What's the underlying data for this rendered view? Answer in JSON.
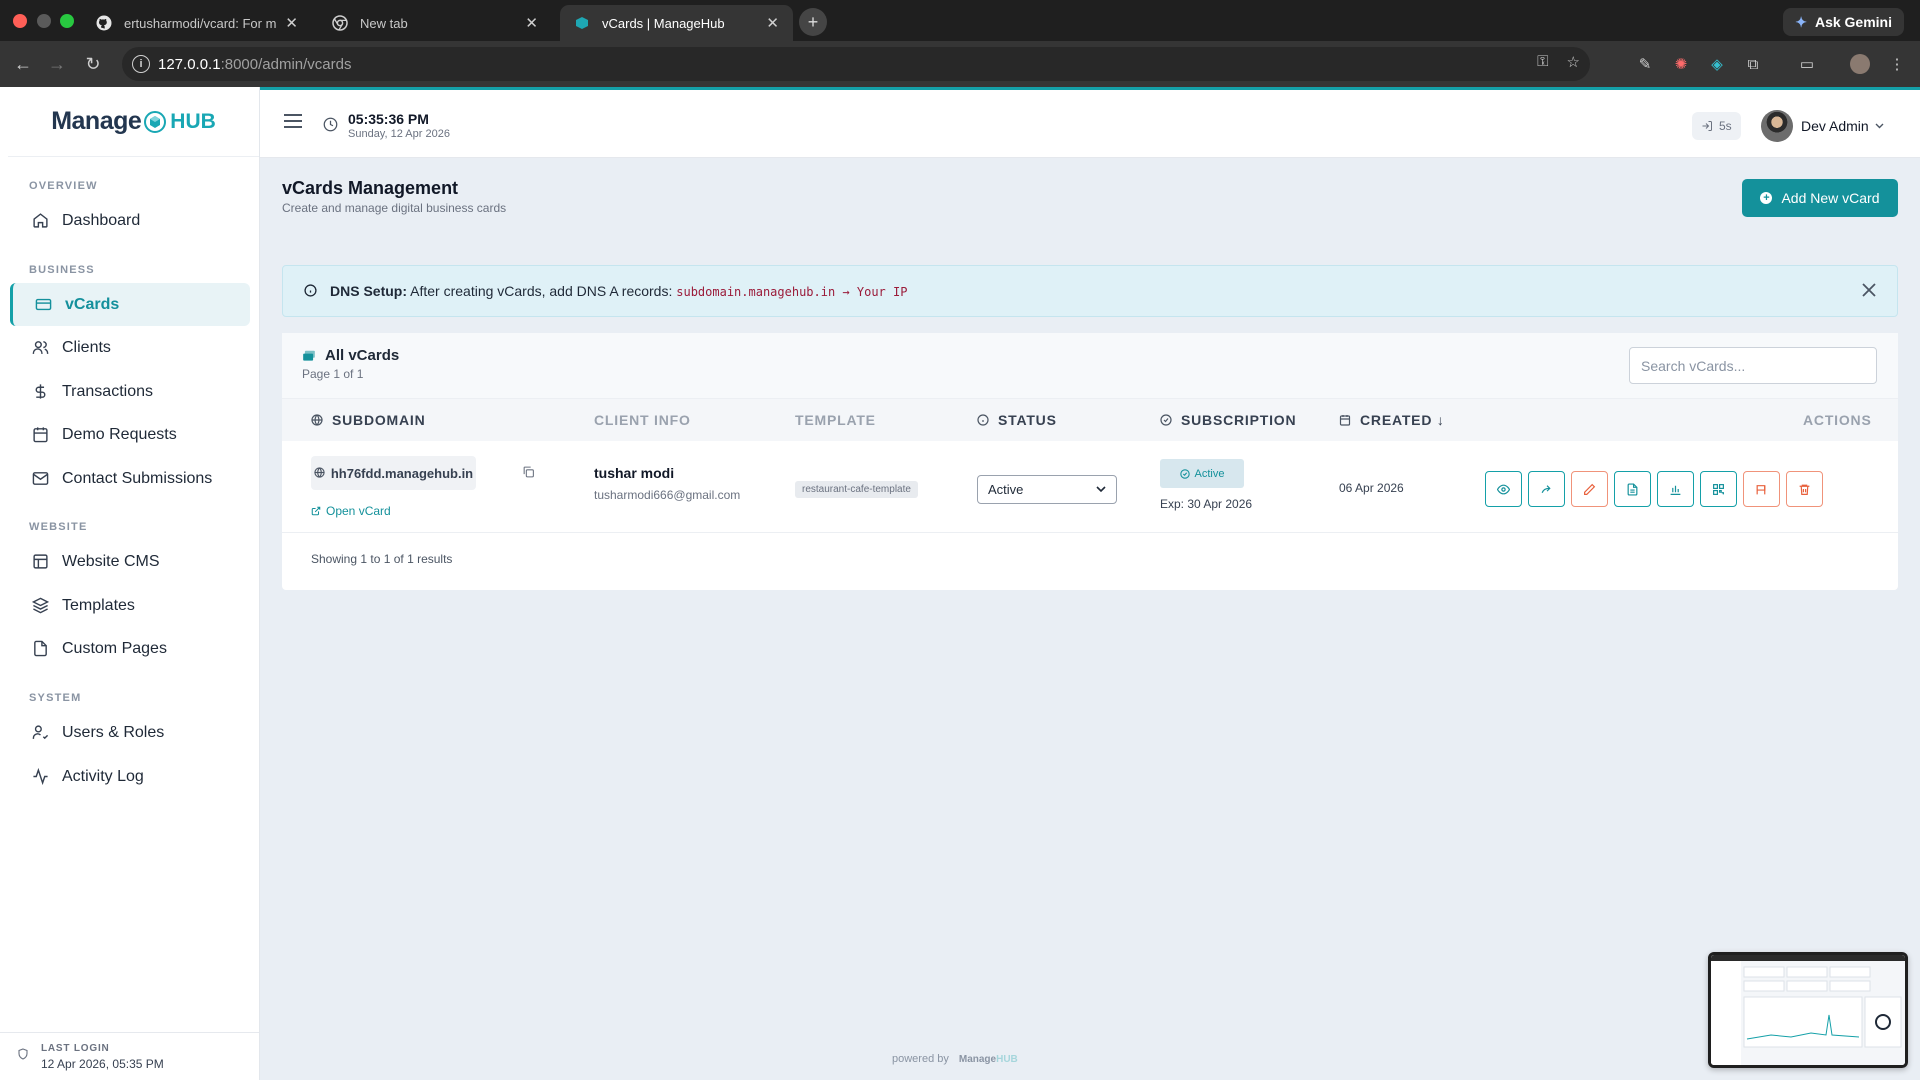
{
  "browser": {
    "tabs": [
      {
        "title": "ertusharmodi/vcard: For mana",
        "favicon": "github-icon"
      },
      {
        "title": "New tab",
        "favicon": "chrome-icon"
      },
      {
        "title": "vCards | ManageHub",
        "favicon": "managehub-icon"
      }
    ],
    "ask_gemini": "Ask Gemini",
    "url_host": "127.0.0.1",
    "url_path": ":8000/admin/vcards"
  },
  "brand": {
    "word": "Manage",
    "hub": "HUB"
  },
  "sidebar": {
    "sections": [
      "OVERVIEW",
      "BUSINESS",
      "WEBSITE",
      "SYSTEM"
    ],
    "items": [
      {
        "label": "Dashboard",
        "icon": "home-icon"
      },
      {
        "label": "vCards",
        "icon": "card-icon"
      },
      {
        "label": "Clients",
        "icon": "users-icon"
      },
      {
        "label": "Transactions",
        "icon": "dollar-icon"
      },
      {
        "label": "Demo Requests",
        "icon": "calendar-icon"
      },
      {
        "label": "Contact Submissions",
        "icon": "mail-icon"
      },
      {
        "label": "Website CMS",
        "icon": "layout-icon"
      },
      {
        "label": "Templates",
        "icon": "layers-icon"
      },
      {
        "label": "Custom Pages",
        "icon": "file-icon"
      },
      {
        "label": "Users & Roles",
        "icon": "user-check-icon"
      },
      {
        "label": "Activity Log",
        "icon": "activity-icon"
      }
    ],
    "footer": {
      "label": "LAST LOGIN",
      "value": "12 Apr 2026, 05:35 PM"
    }
  },
  "header": {
    "time": "05:35:36 PM",
    "date": "Sunday, 12 Apr 2026",
    "session": "5s",
    "user": "Dev Admin"
  },
  "page": {
    "title": "vCards Management",
    "subtitle": "Create and manage digital business cards",
    "add_button": "Add New vCard"
  },
  "alert": {
    "bold": "DNS Setup:",
    "text": "After creating vCards, add DNS A records:",
    "code": "subdomain.managehub.in → Your IP"
  },
  "card": {
    "title": "All vCards",
    "subtitle": "Page 1 of 1",
    "search_placeholder": "Search vCards..."
  },
  "table": {
    "columns": [
      "SUBDOMAIN",
      "CLIENT INFO",
      "TEMPLATE",
      "STATUS",
      "SUBSCRIPTION",
      "CREATED ↓",
      "ACTIONS"
    ],
    "rows": [
      {
        "subdomain": "hh76fdd.managehub.in",
        "open_link": "Open vCard",
        "client_name": "tushar modi",
        "client_email": "tusharmodi666@gmail.com",
        "template": "restaurant-cafe-template",
        "status": "Active",
        "subscription": "Active",
        "expiry": "Exp: 30 Apr 2026",
        "created": "06 Apr 2026"
      }
    ],
    "footer": "Showing 1 to 1 of 1 results"
  },
  "powered": {
    "label": "powered by",
    "logo": "Manage",
    "logo_hub": "HUB"
  },
  "colors": {
    "accent": "#14919b",
    "danger": "#e8603c",
    "sidebar_active_bg": "#e8f3f6"
  }
}
